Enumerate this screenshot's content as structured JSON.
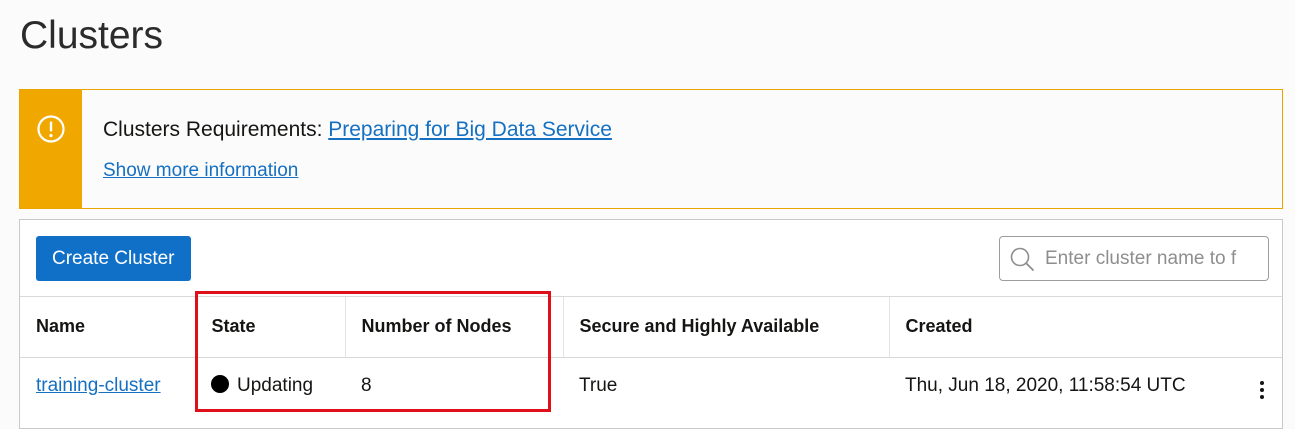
{
  "page": {
    "title": "Clusters"
  },
  "notice": {
    "prefix": "Clusters Requirements: ",
    "link_text": "Preparing for Big Data Service",
    "more_link": "Show more information",
    "icon": "warning-circle-icon",
    "accent_color": "#f0a800"
  },
  "toolbar": {
    "create_label": "Create Cluster",
    "search_placeholder": "Enter cluster name to f",
    "button_color": "#1070c8"
  },
  "table": {
    "columns": [
      "Name",
      "State",
      "Number of Nodes",
      "Secure and Highly Available",
      "Created"
    ],
    "rows": [
      {
        "name": "training-cluster",
        "state": "Updating",
        "nodes": "8",
        "secure": "True",
        "created": "Thu, Jun 18, 2020, 11:58:54 UTC"
      }
    ]
  },
  "annotation": {
    "highlight_color": "#e0101a"
  }
}
